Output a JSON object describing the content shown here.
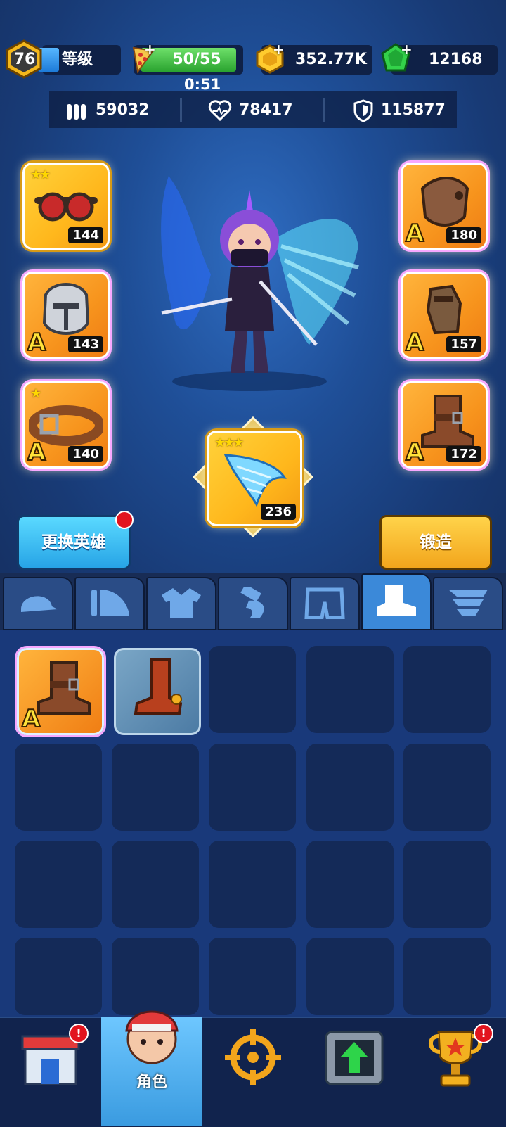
{
  "hud": {
    "level": "76",
    "level_label": "等级",
    "energy": "50/55",
    "energy_timer": "0:51",
    "gold": "352.77K",
    "gems": "12168"
  },
  "stats": {
    "attack": "59032",
    "health": "78417",
    "defense": "115877"
  },
  "equipment": {
    "left": [
      {
        "name": "goggles",
        "count": "144",
        "stars": "★★",
        "grade": ""
      },
      {
        "name": "helmet",
        "count": "143",
        "stars": "",
        "grade": "A"
      },
      {
        "name": "belt",
        "count": "140",
        "stars": "★",
        "grade": "A"
      }
    ],
    "right": [
      {
        "name": "armor",
        "count": "180",
        "grade": "A"
      },
      {
        "name": "gauntlet",
        "count": "157",
        "grade": "A"
      },
      {
        "name": "boots",
        "count": "172",
        "grade": "A"
      }
    ],
    "wings": {
      "count": "236",
      "stars": "★★★"
    }
  },
  "buttons": {
    "change_hero": "更换英雄",
    "forge": "锻造"
  },
  "tabs": [
    "hat",
    "pauldron",
    "shirt",
    "gauntlet",
    "shorts",
    "boot",
    "wings"
  ],
  "inventory": [
    {
      "name": "brown-boot",
      "grade": "A"
    },
    {
      "name": "spur-boot",
      "grade": ""
    }
  ],
  "nav": {
    "character_label": "角色",
    "items": [
      "shop",
      "character",
      "target",
      "upgrade",
      "trophy"
    ]
  },
  "colors": {
    "accent_blue": "#3b89d9",
    "gold": "#ffd23a",
    "alert_red": "#e2141e",
    "energy_green": "#2aa32f",
    "gem_green": "#2ecc40"
  }
}
